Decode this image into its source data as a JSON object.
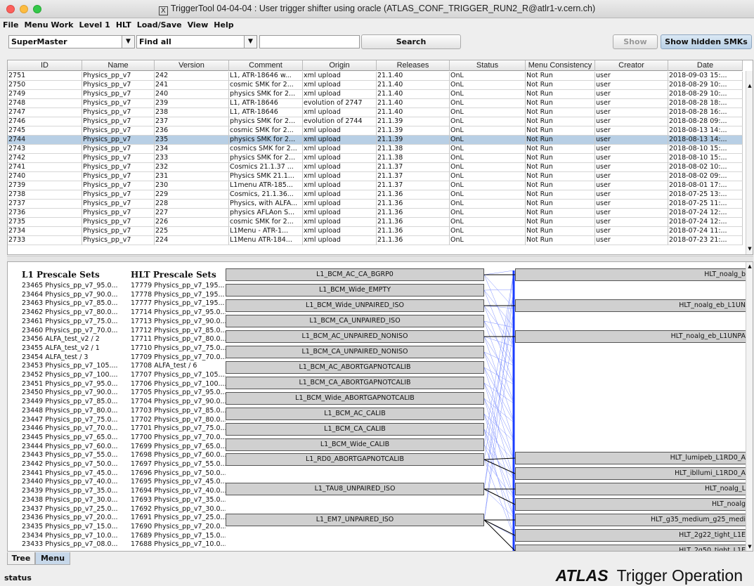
{
  "window": {
    "title": "TriggerTool 04-04-04 : User trigger shifter using oracle (ATLAS_CONF_TRIGGER_RUN2_R@atlr1-v.cern.ch)",
    "x11_glyph": "X"
  },
  "menubar": [
    "File",
    "Menu Work",
    "Level 1",
    "HLT",
    "Load/Save",
    "View",
    "Help"
  ],
  "toolbar": {
    "type_select": "SuperMaster",
    "filter_select": "Find all",
    "search_value": "",
    "search_label": "Search",
    "show_label": "Show",
    "show_hidden_label": "Show hidden SMKs"
  },
  "table": {
    "columns": [
      "ID",
      "Name",
      "Version",
      "Comment",
      "Origin",
      "Releases",
      "Status",
      "Menu Consistency",
      "Creator",
      "Date"
    ],
    "selected_row": 7,
    "rows": [
      [
        "2751",
        "Physics_pp_v7",
        "242",
        "L1, ATR-18646 w...",
        "xml upload",
        "21.1.40",
        "OnL",
        "Not Run",
        "user",
        "2018-09-03 15:..."
      ],
      [
        "2750",
        "Physics_pp_v7",
        "241",
        "cosmic SMK for 2...",
        "xml upload",
        "21.1.40",
        "OnL",
        "Not Run",
        "user",
        "2018-08-29 10:..."
      ],
      [
        "2749",
        "Physics_pp_v7",
        "240",
        "physics SMK for 2...",
        "xml upload",
        "21.1.40",
        "OnL",
        "Not Run",
        "user",
        "2018-08-29 10:..."
      ],
      [
        "2748",
        "Physics_pp_v7",
        "239",
        "L1, ATR-18646",
        "evolution of 2747",
        "21.1.40",
        "OnL",
        "Not Run",
        "user",
        "2018-08-28 18:..."
      ],
      [
        "2747",
        "Physics_pp_v7",
        "238",
        "L1, ATR-18646",
        "xml upload",
        "21.1.40",
        "OnL",
        "Not Run",
        "user",
        "2018-08-28 16:..."
      ],
      [
        "2746",
        "Physics_pp_v7",
        "237",
        "physics SMK for 2...",
        "evolution of 2744",
        "21.1.39",
        "OnL",
        "Not Run",
        "user",
        "2018-08-28 09:..."
      ],
      [
        "2745",
        "Physics_pp_v7",
        "236",
        "cosmic SMK for 2...",
        "xml upload",
        "21.1.39",
        "OnL",
        "Not Run",
        "user",
        "2018-08-13 14:..."
      ],
      [
        "2744",
        "Physics_pp_v7",
        "235",
        "physics SMK for 2...",
        "xml upload",
        "21.1.39",
        "OnL",
        "Not Run",
        "user",
        "2018-08-13 14:..."
      ],
      [
        "2743",
        "Physics_pp_v7",
        "234",
        "cosmics SMK for 2...",
        "xml upload",
        "21.1.38",
        "OnL",
        "Not Run",
        "user",
        "2018-08-10 15:..."
      ],
      [
        "2742",
        "Physics_pp_v7",
        "233",
        "physics SMK for 2...",
        "xml upload",
        "21.1.38",
        "OnL",
        "Not Run",
        "user",
        "2018-08-10 15:..."
      ],
      [
        "2741",
        "Physics_pp_v7",
        "232",
        "Cosmics 21.1.37 ...",
        "xml upload",
        "21.1.37",
        "OnL",
        "Not Run",
        "user",
        "2018-08-02 10:..."
      ],
      [
        "2740",
        "Physics_pp_v7",
        "231",
        "Physics SMK 21.1...",
        "xml upload",
        "21.1.37",
        "OnL",
        "Not Run",
        "user",
        "2018-08-02 09:..."
      ],
      [
        "2739",
        "Physics_pp_v7",
        "230",
        "L1menu ATR-185...",
        "xml upload",
        "21.1.37",
        "OnL",
        "Not Run",
        "user",
        "2018-08-01 17:..."
      ],
      [
        "2738",
        "Physics_pp_v7",
        "229",
        "Cosmics, 21.1.36...",
        "xml upload",
        "21.1.36",
        "OnL",
        "Not Run",
        "user",
        "2018-07-25 13:..."
      ],
      [
        "2737",
        "Physics_pp_v7",
        "228",
        "Physics, with ALFA...",
        "xml upload",
        "21.1.36",
        "OnL",
        "Not Run",
        "user",
        "2018-07-25 11:..."
      ],
      [
        "2736",
        "Physics_pp_v7",
        "227",
        "physics AFLAon S...",
        "xml upload",
        "21.1.36",
        "OnL",
        "Not Run",
        "user",
        "2018-07-24 12:..."
      ],
      [
        "2735",
        "Physics_pp_v7",
        "226",
        "cosmic SMK for 2...",
        "xml upload",
        "21.1.36",
        "OnL",
        "Not Run",
        "user",
        "2018-07-24 12:..."
      ],
      [
        "2734",
        "Physics_pp_v7",
        "225",
        "L1Menu - ATR-1...",
        "xml upload",
        "21.1.36",
        "OnL",
        "Not Run",
        "user",
        "2018-07-24 11:..."
      ],
      [
        "2733",
        "Physics_pp_v7",
        "224",
        "L1Menu ATR-184...",
        "xml upload",
        "21.1.36",
        "OnL",
        "Not Run",
        "user",
        "2018-07-23 21:..."
      ]
    ]
  },
  "prescales": {
    "l1_title": "L1 Prescale Sets",
    "hlt_title": "HLT Prescale Sets",
    "l1_sets": [
      "23465 Physics_pp_v7_95.0...",
      "23464 Physics_pp_v7_90.0...",
      "23463 Physics_pp_v7_85.0...",
      "23462 Physics_pp_v7_80.0...",
      "23461 Physics_pp_v7_75.0...",
      "23460 Physics_pp_v7_70.0...",
      "23456 ALFA_test_v2 / 2",
      "23455 ALFA_test_v2 / 1",
      "23454 ALFA_test / 3",
      "23453 Physics_pp_v7_105....",
      "23452 Physics_pp_v7_100....",
      "23451 Physics_pp_v7_95.0...",
      "23450 Physics_pp_v7_90.0...",
      "23449 Physics_pp_v7_85.0...",
      "23448 Physics_pp_v7_80.0...",
      "23447 Physics_pp_v7_75.0...",
      "23446 Physics_pp_v7_70.0...",
      "23445 Physics_pp_v7_65.0...",
      "23444 Physics_pp_v7_60.0...",
      "23443 Physics_pp_v7_55.0...",
      "23442 Physics_pp_v7_50.0...",
      "23441 Physics_pp_v7_45.0...",
      "23440 Physics_pp_v7_40.0...",
      "23439 Physics_pp_v7_35.0...",
      "23438 Physics_pp_v7_30.0...",
      "23437 Physics_pp_v7_25.0...",
      "23436 Physics_pp_v7_20.0...",
      "23435 Physics_pp_v7_15.0...",
      "23434 Physics_pp_v7_10.0...",
      "23433 Physics_pp_v7_08.0..."
    ],
    "hlt_sets": [
      "17779 Physics_pp_v7_195...",
      "17778 Physics_pp_v7_195...",
      "17777 Physics_pp_v7_195...",
      "17714 Physics_pp_v7_95.0...",
      "17713 Physics_pp_v7_90.0...",
      "17712 Physics_pp_v7_85.0...",
      "17711 Physics_pp_v7_80.0...",
      "17710 Physics_pp_v7_75.0...",
      "17709 Physics_pp_v7_70.0...",
      "17708 ALFA_test / 6",
      "17707 Physics_pp_v7_105....",
      "17706 Physics_pp_v7_100....",
      "17705 Physics_pp_v7_95.0...",
      "17704 Physics_pp_v7_90.0...",
      "17703 Physics_pp_v7_85.0...",
      "17702 Physics_pp_v7_80.0...",
      "17701 Physics_pp_v7_75.0...",
      "17700 Physics_pp_v7_70.0...",
      "17699 Physics_pp_v7_65.0...",
      "17698 Physics_pp_v7_60.0...",
      "17697 Physics_pp_v7_55.0...",
      "17696 Physics_pp_v7_50.0...",
      "17695 Physics_pp_v7_45.0...",
      "17694 Physics_pp_v7_40.0...",
      "17693 Physics_pp_v7_35.0...",
      "17692 Physics_pp_v7_30.0...",
      "17691 Physics_pp_v7_25.0...",
      "17690 Physics_pp_v7_20.0...",
      "17689 Physics_pp_v7_15.0...",
      "17688 Physics_pp_v7_10.0..."
    ]
  },
  "l1_items": [
    "L1_BCM_AC_CA_BGRP0",
    "L1_BCM_Wide_EMPTY",
    "L1_BCM_Wide_UNPAIRED_ISO",
    "L1_BCM_CA_UNPAIRED_ISO",
    "L1_BCM_AC_UNPAIRED_NONISO",
    "L1_BCM_CA_UNPAIRED_NONISO",
    "L1_BCM_AC_ABORTGAPNOTCALIB",
    "L1_BCM_CA_ABORTGAPNOTCALIB",
    "L1_BCM_Wide_ABORTGAPNOTCALIB",
    "L1_BCM_AC_CALIB",
    "L1_BCM_CA_CALIB",
    "L1_BCM_Wide_CALIB",
    "L1_RD0_ABORTGAPNOTCALIB",
    "L1_TAU8_UNPAIRED_ISO",
    "L1_EM7_UNPAIRED_ISO"
  ],
  "hlt_items": [
    "HLT_noalg_b",
    "HLT_noalg_eb_L1UN",
    "HLT_noalg_eb_L1UNPA",
    "HLT_lumipeb_L1RD0_A",
    "HLT_ibllumi_L1RD0_A",
    "HLT_noalg_L",
    "HLT_noalg",
    "HLT_g35_medium_g25_medi",
    "HLT_2g22_tight_L1E",
    "HLT_2g50_tight_L1E"
  ],
  "tabs": [
    "Tree",
    "Menu"
  ],
  "status": {
    "text": "status",
    "brand_bold": "ATLAS",
    "brand_rest": "Trigger Operation"
  },
  "colors": {
    "selection": "#b8cfe5",
    "link_line": "#1a3cff",
    "box_fill": "#d0d0d0"
  }
}
